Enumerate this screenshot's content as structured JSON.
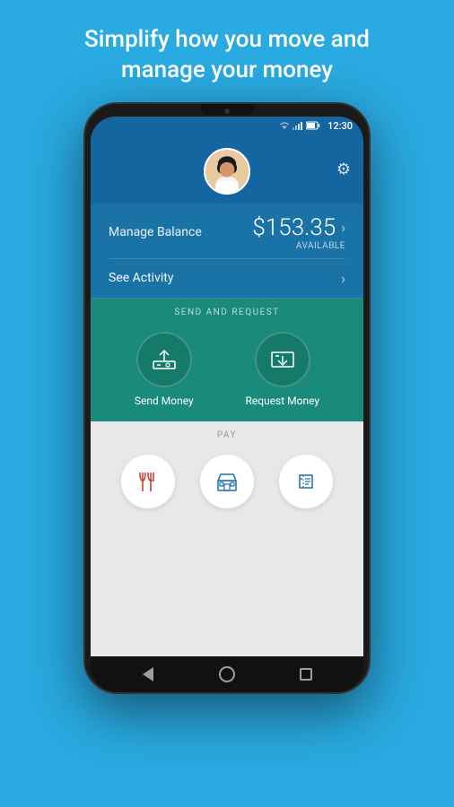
{
  "headline": {
    "line1": "Simplify how you move and",
    "line2": "manage your money"
  },
  "statusBar": {
    "time": "12:30"
  },
  "header": {
    "gearLabel": "⚙"
  },
  "balance": {
    "manageLabel": "Manage Balance",
    "amount": "$153.35",
    "availableLabel": "AVAILABLE"
  },
  "activity": {
    "label": "See Activity"
  },
  "sendRequest": {
    "sectionLabel": "SEND AND REQUEST",
    "sendLabel": "Send Money",
    "requestLabel": "Request Money"
  },
  "pay": {
    "sectionLabel": "PAY"
  },
  "nav": {
    "backLabel": "back",
    "homeLabel": "home",
    "recentLabel": "recent"
  }
}
